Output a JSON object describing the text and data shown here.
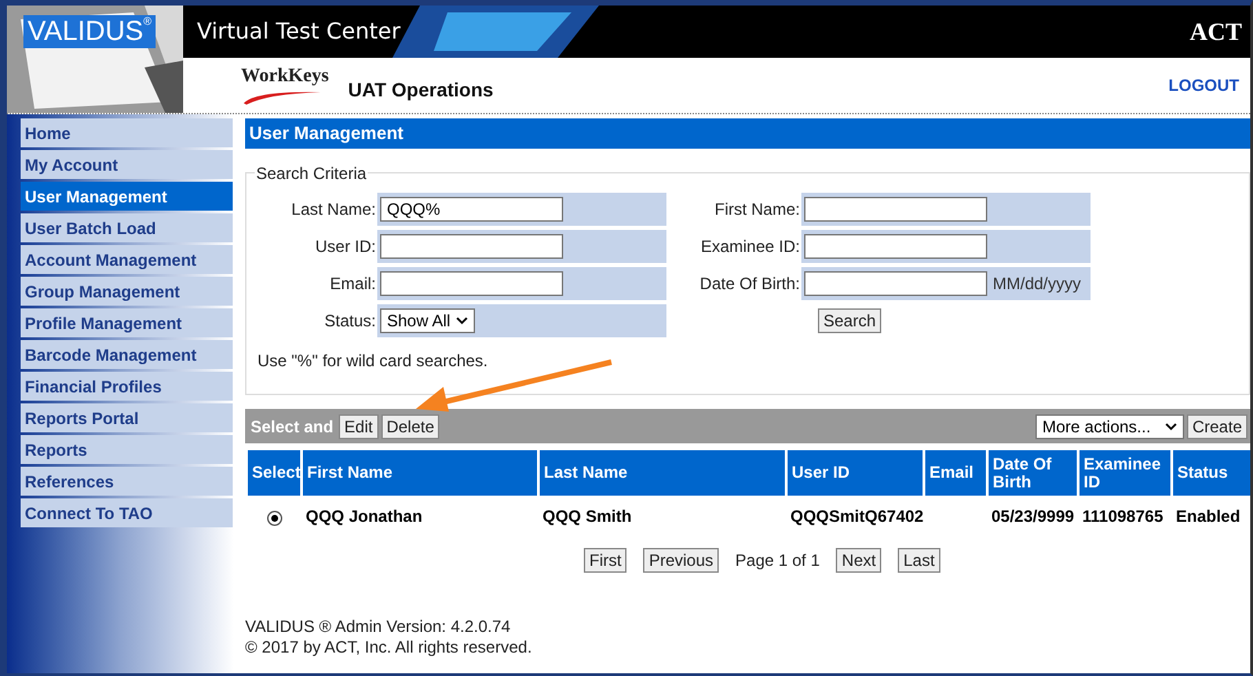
{
  "header": {
    "brand": "VALIDUS",
    "brand_mark": "®",
    "title": "Virtual Test Center",
    "act_logo": "ACT",
    "workkeys": "WorkKeys",
    "org": "UAT Operations",
    "logout": "LOGOUT"
  },
  "sidebar": {
    "items": [
      {
        "label": "Home",
        "selected": false
      },
      {
        "label": "My Account",
        "selected": false
      },
      {
        "label": "User Management",
        "selected": true
      },
      {
        "label": "User Batch Load",
        "selected": false
      },
      {
        "label": "Account Management",
        "selected": false
      },
      {
        "label": "Group Management",
        "selected": false
      },
      {
        "label": "Profile Management",
        "selected": false
      },
      {
        "label": "Barcode Management",
        "selected": false
      },
      {
        "label": "Financial Profiles",
        "selected": false
      },
      {
        "label": "Reports Portal",
        "selected": false
      },
      {
        "label": "Reports",
        "selected": false
      },
      {
        "label": "References",
        "selected": false
      },
      {
        "label": "Connect To TAO",
        "selected": false
      }
    ]
  },
  "page_title": "User Management",
  "search": {
    "legend": "Search Criteria",
    "left_fields": [
      {
        "kind": "text",
        "label": "Last Name:",
        "value": "QQQ%"
      },
      {
        "kind": "text",
        "label": "User ID:"
      },
      {
        "kind": "text",
        "label": "Email:"
      },
      {
        "kind": "select",
        "label": "Status:",
        "value": "Show All"
      }
    ],
    "right_fields": [
      {
        "kind": "text",
        "label": "First Name:"
      },
      {
        "kind": "text",
        "label": "Examinee ID:"
      },
      {
        "kind": "text",
        "label": "Date Of Birth:",
        "hint": "MM/dd/yyyy"
      }
    ],
    "button": "Search",
    "note": "Use \"%\" for wild card searches."
  },
  "actions": {
    "label": "Select and",
    "buttons": [
      "Edit",
      "Delete"
    ],
    "more": "More actions...",
    "create": "Create"
  },
  "table": {
    "columns": [
      "Select",
      "First Name",
      "Last Name",
      "User ID",
      "Email",
      "Date Of Birth",
      "Examinee ID",
      "Status"
    ],
    "rows": [
      {
        "selected": true,
        "cells": [
          "",
          "QQQ Jonathan",
          "QQQ Smith",
          "QQQSmitQ67402",
          "",
          "05/23/9999",
          "111098765",
          "Enabled"
        ]
      }
    ]
  },
  "pagination": {
    "first": "First",
    "previous": "Previous",
    "info": "Page 1 of 1",
    "next": "Next",
    "last": "Last"
  },
  "footer": [
    "VALIDUS ® Admin Version: 4.2.0.74",
    "© 2017 by ACT, Inc. All rights reserved."
  ]
}
